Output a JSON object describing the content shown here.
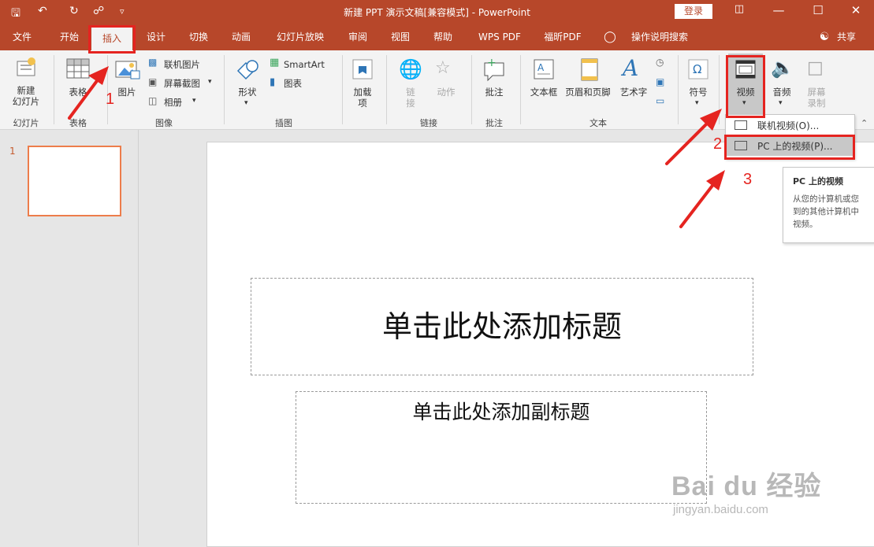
{
  "titlebar": {
    "title": "新建 PPT 演示文稿[兼容模式] - PowerPoint",
    "login": "登录",
    "icons": [
      "save-icon",
      "undo-icon",
      "redo-icon",
      "present-icon",
      "customize-qat-icon"
    ],
    "window_controls": [
      "ribbon-display-icon",
      "minimize-icon",
      "maximize-icon",
      "close-icon"
    ]
  },
  "tabs": [
    "文件",
    "开始",
    "插入",
    "设计",
    "切换",
    "动画",
    "幻灯片放映",
    "审阅",
    "视图",
    "帮助",
    "WPS PDF",
    "福昕PDF",
    "操作说明搜索"
  ],
  "active_tab": "插入",
  "share": "共享",
  "ribbon": {
    "new_slide": {
      "line1": "新建",
      "line2": "幻灯片"
    },
    "table": "表格",
    "picture": "图片",
    "online_picture": "联机图片",
    "screenshot": "屏幕截图",
    "album": "相册",
    "shapes": "形状",
    "smartart": "SmartArt",
    "chart": "图表",
    "addins": {
      "line1": "加载",
      "line2": "项"
    },
    "link": {
      "line1": "链",
      "line2": "接"
    },
    "action": "动作",
    "comment": "批注",
    "textbox": "文本框",
    "header_footer": "页眉和页脚",
    "wordart": "艺术字",
    "symbol": "符号",
    "video": "视频",
    "audio": "音频",
    "screen_recording": {
      "line1": "屏幕",
      "line2": "录制"
    },
    "groups": [
      "幻灯片",
      "表格",
      "图像",
      "插图",
      "链接",
      "批注",
      "文本"
    ]
  },
  "dropdown": {
    "online_video": "联机视频(O)...",
    "pc_video": "PC 上的视频(P)..."
  },
  "tooltip": {
    "title": "PC 上的视频",
    "lines": [
      "从您的计算机或您",
      "到的其他计算机中",
      "视频。"
    ]
  },
  "slide_panel": {
    "number": "1"
  },
  "slide": {
    "title_placeholder": "单击此处添加标题",
    "subtitle_placeholder": "单击此处添加副标题"
  },
  "annotations": {
    "step1": "1",
    "step2": "2",
    "step3": "3",
    "color": "#e52420"
  },
  "watermark": {
    "logo": "Bai du 经验",
    "url": "jingyan.baidu.com"
  },
  "colors": {
    "accent": "#b7472a",
    "ribbon_bg": "#f3f3f3",
    "thumb_border": "#ed7d4b"
  }
}
